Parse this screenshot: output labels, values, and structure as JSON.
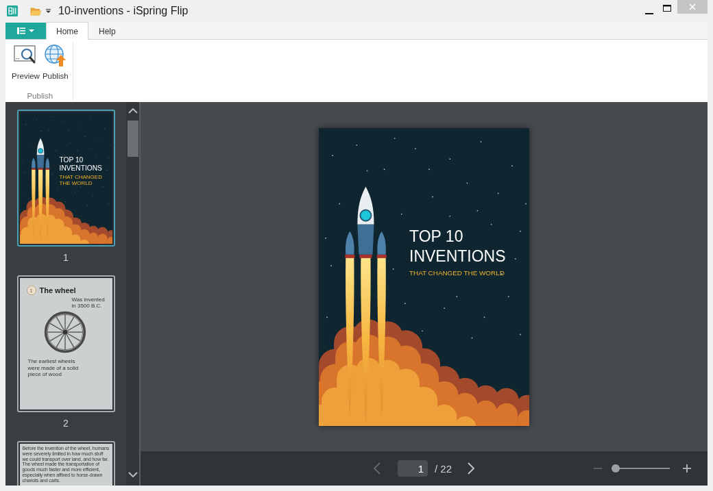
{
  "window": {
    "title": "10-inventions - iSpring Flip"
  },
  "ribbon": {
    "tabs": [
      {
        "label": "Home",
        "selected": true
      },
      {
        "label": "Help",
        "selected": false
      }
    ],
    "groups": [
      {
        "label": "Publish",
        "buttons": [
          {
            "kind": "preview",
            "label": "Preview"
          },
          {
            "kind": "publish",
            "label": "Publish"
          }
        ]
      }
    ]
  },
  "thumbnails": [
    {
      "kind": "cover",
      "selected": true,
      "number": "1",
      "title_lines": [
        "TOP 10",
        "INVENTIONS"
      ],
      "subtitle": "THAT CHANGED THE WORLD"
    },
    {
      "kind": "chapter",
      "selected": false,
      "number": "2",
      "badge": "1",
      "heading": "The wheel",
      "note": "Was invented in 3500 B.C.",
      "caption": "The earliest wheels were made of a solid piece of wood"
    },
    {
      "kind": "text",
      "selected": false,
      "body": "Before the invention of the wheel, humans were severely limited in how much stuff we could transport over land, and how far. The wheel made the transportation of goods much faster and more efficient, especially when affixed to horse-drawn chariots and carts."
    }
  ],
  "page": {
    "kind": "cover",
    "title_lines": [
      "TOP 10",
      "INVENTIONS"
    ],
    "subtitle": "THAT CHANGED THE WORLD"
  },
  "navigation": {
    "previous": {
      "disabled": true
    },
    "page": "1",
    "total": "/ 22",
    "next": {
      "disabled": false
    }
  },
  "zoom": {
    "minus": {
      "disabled": true
    },
    "level": 0,
    "plus": {
      "disabled": false
    }
  }
}
